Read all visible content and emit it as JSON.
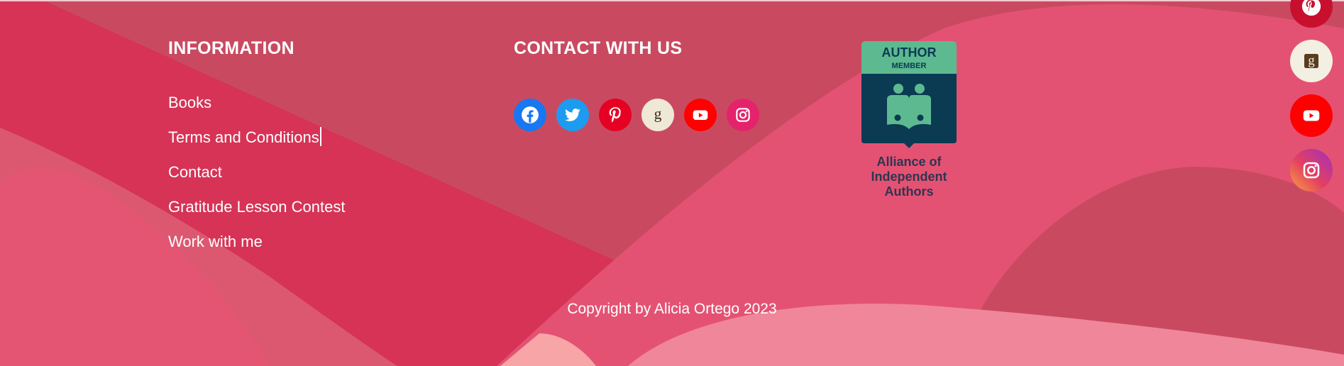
{
  "footer": {
    "information": {
      "title": "INFORMATION",
      "links": [
        "Books",
        "Terms and Conditions",
        "Contact",
        "Gratitude Lesson Contest",
        "Work with me"
      ]
    },
    "contact": {
      "title": "CONTACT WITH US",
      "social_icons": [
        "facebook-icon",
        "twitter-icon",
        "pinterest-icon",
        "goodreads-icon",
        "youtube-icon",
        "instagram-icon"
      ]
    },
    "badge": {
      "line1": "AUTHOR",
      "line2": "MEMBER",
      "line3": "Alliance of",
      "line4": "Independent",
      "line5": "Authors"
    },
    "copyright": "Copyright by Alicia Ortego 2023"
  },
  "floating_social": [
    "pinterest-icon",
    "goodreads-icon",
    "youtube-icon",
    "instagram-icon"
  ],
  "colors": {
    "background": "#c94a60",
    "facebook": "#1877f2",
    "twitter": "#1d9bf0",
    "pinterest": "#e60023",
    "goodreads": "#efe8d8",
    "youtube": "#ff0000",
    "instagram": "#e4405f",
    "badge_green": "#5dba90",
    "badge_navy": "#0b3a53"
  }
}
